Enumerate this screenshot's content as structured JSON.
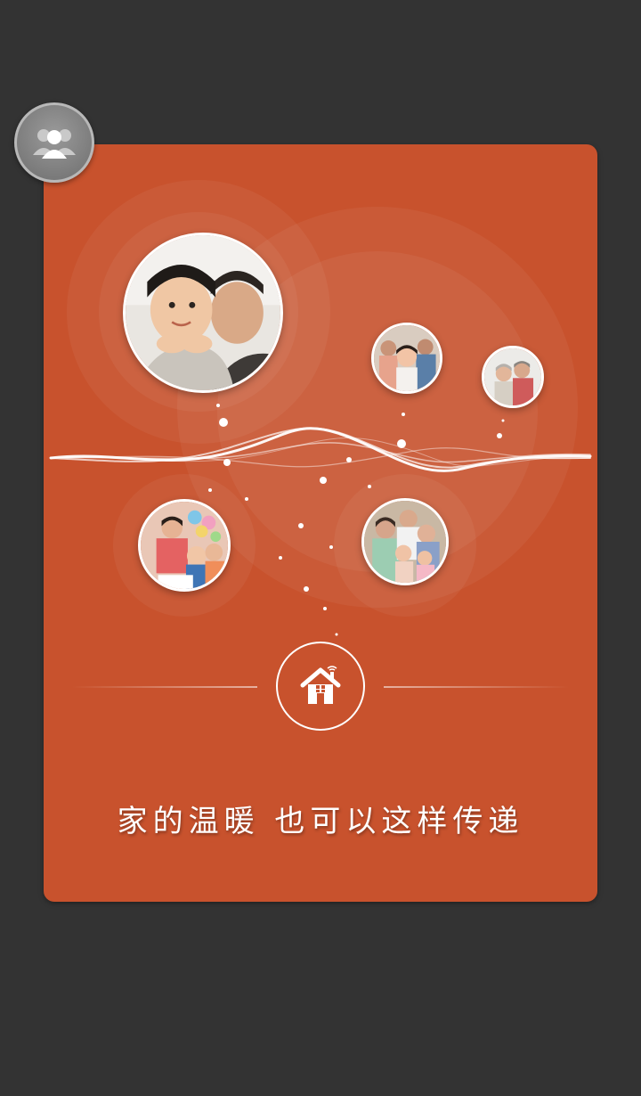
{
  "colors": {
    "background": "#333333",
    "card": "#c8522d",
    "accent": "#ffffff"
  },
  "avatar": {
    "icon": "users-icon"
  },
  "photos": [
    {
      "name": "photo-father-son",
      "subject": "father-son"
    },
    {
      "name": "photo-family-group",
      "subject": "family-group"
    },
    {
      "name": "photo-grandparents",
      "subject": "grandparents"
    },
    {
      "name": "photo-birthday-party",
      "subject": "birthday-party"
    },
    {
      "name": "photo-family-portrait",
      "subject": "family-portrait"
    }
  ],
  "home": {
    "icon": "home-wifi-icon"
  },
  "slogan": "家的温暖 也可以这样传递"
}
